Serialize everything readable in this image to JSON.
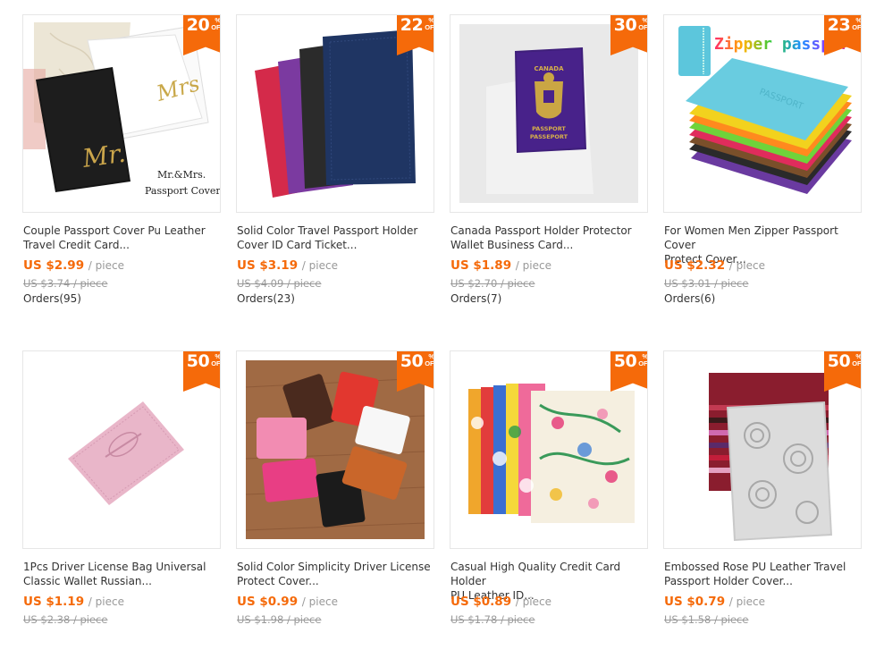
{
  "products": [
    {
      "title_line1": "Couple Passport Cover Pu Leather",
      "title_line2": "Travel Credit Card...",
      "price": "US $2.99",
      "unit": "/ piece",
      "original_price": "US $3.74 / piece",
      "orders": "Orders(95)",
      "discount": "20",
      "badge_pct": "%",
      "badge_off": "OFF",
      "image_text_1": "Mr.&Mrs.",
      "image_text_2": "Passport Cover",
      "image_script_1": "Mr.",
      "image_script_2": "Mrs"
    },
    {
      "title_line1": "Solid Color Travel Passport Holder",
      "title_line2": "Cover ID Card Ticket...",
      "price": "US $3.19",
      "unit": "/ piece",
      "original_price": "US $4.09 / piece",
      "orders": "Orders(23)",
      "discount": "22",
      "badge_pct": "%",
      "badge_off": "OFF"
    },
    {
      "title_line1": "Canada Passport Holder Protector",
      "title_line2": "Wallet Business Card...",
      "price": "US $1.89",
      "unit": "/ piece",
      "original_price": "US $2.70 / piece",
      "orders": "Orders(7)",
      "discount": "30",
      "badge_pct": "%",
      "badge_off": "OFF",
      "image_text_1": "CANADA",
      "image_text_2": "PASSPORT",
      "image_text_3": "PASSEPORT"
    },
    {
      "title_line1": "For Women Men Zipper Passport Cover",
      "title_line2": "Protect Cover...",
      "price": "US $2.32",
      "unit": "/ piece",
      "original_price": "US $3.01 / piece",
      "orders": "Orders(6)",
      "discount": "23",
      "badge_pct": "%",
      "badge_off": "OFF",
      "image_text_1": "Zipper passport",
      "image_text_2": "PASSPORT"
    },
    {
      "title_line1": "1Pcs Driver License Bag Universal",
      "title_line2": "Classic Wallet Russian...",
      "price": "US $1.19",
      "unit": "/ piece",
      "original_price": "US $2.38 / piece",
      "orders": "",
      "discount": "50",
      "badge_pct": "%",
      "badge_off": "OFF"
    },
    {
      "title_line1": "Solid Color Simplicity Driver License",
      "title_line2": "Protect Cover...",
      "price": "US $0.99",
      "unit": "/ piece",
      "original_price": "US $1.98 / piece",
      "orders": "",
      "discount": "50",
      "badge_pct": "%",
      "badge_off": "OFF"
    },
    {
      "title_line1": "Casual High Quality Credit Card Holder",
      "title_line2": "PU Leather ID...",
      "price": "US $0.89",
      "unit": "/ piece",
      "original_price": "US $1.78 / piece",
      "orders": "",
      "discount": "50",
      "badge_pct": "%",
      "badge_off": "OFF"
    },
    {
      "title_line1": "Embossed Rose PU Leather Travel",
      "title_line2": "Passport Holder Cover...",
      "price": "US $0.79",
      "unit": "/ piece",
      "original_price": "US $1.58 / piece",
      "orders": "",
      "discount": "50",
      "badge_pct": "%",
      "badge_off": "OFF"
    }
  ],
  "colors": {
    "accent": "#f56a0a",
    "strike": "#999999",
    "text": "#333333"
  }
}
